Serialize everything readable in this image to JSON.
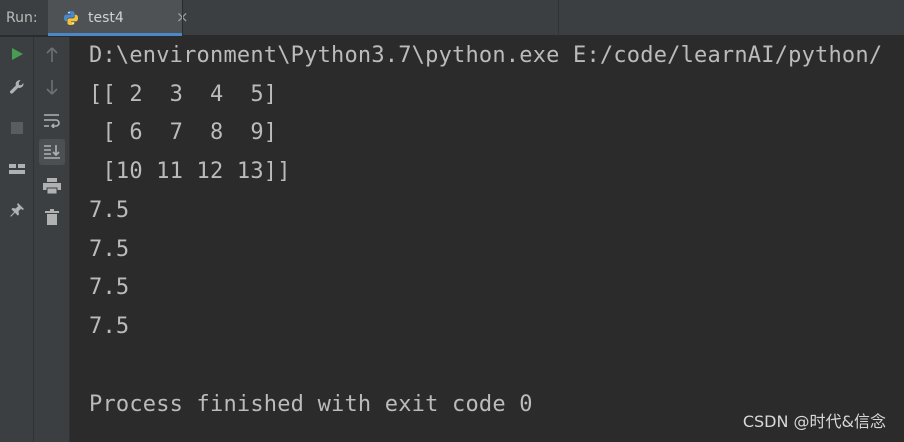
{
  "header": {
    "run_label": "Run:",
    "tab_name": "test4",
    "tab_close": "×"
  },
  "toolbar_left": {
    "icons": [
      "run-icon",
      "wrench-icon",
      "stop-icon",
      "layout-icon",
      "pin-icon"
    ]
  },
  "toolbar_second": {
    "icons": [
      "arrow-up-icon",
      "arrow-down-icon",
      "soft-wrap-icon",
      "scroll-to-end-icon",
      "print-icon",
      "trash-icon"
    ]
  },
  "console": {
    "lines": [
      "D:\\environment\\Python3.7\\python.exe E:/code/learnAI/python/",
      "[[ 2  3  4  5]",
      " [ 6  7  8  9]",
      " [10 11 12 13]]",
      "7.5",
      "7.5",
      "7.5",
      "7.5",
      "",
      "Process finished with exit code 0"
    ]
  },
  "watermark": "CSDN @时代&信念",
  "colors": {
    "background": "#2b2b2b",
    "toolbar": "#3c3f41",
    "text": "#bbbbbb",
    "run_green": "#499c54",
    "tab_underline": "#4a88c7"
  }
}
